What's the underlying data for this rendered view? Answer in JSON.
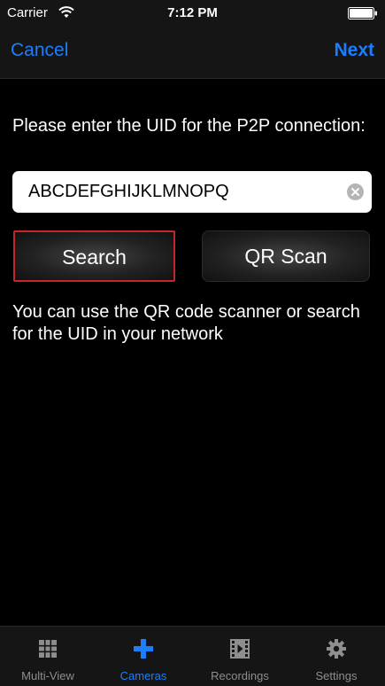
{
  "status_bar": {
    "carrier": "Carrier",
    "time": "7:12 PM"
  },
  "nav": {
    "cancel_label": "Cancel",
    "next_label": "Next"
  },
  "prompt": "Please enter the UID for the P2P connection:",
  "uid_input": {
    "value": "ABCDEFGHIJKLMNOPQ"
  },
  "buttons": {
    "search_label": "Search",
    "qr_scan_label": "QR Scan"
  },
  "hint": "You can use the QR code scanner or search for the UID in your network",
  "tabs": [
    {
      "label": "Multi-View",
      "icon": "grid-icon",
      "active": false
    },
    {
      "label": "Cameras",
      "icon": "plus-icon",
      "active": true
    },
    {
      "label": "Recordings",
      "icon": "film-icon",
      "active": false
    },
    {
      "label": "Settings",
      "icon": "gear-icon",
      "active": false
    }
  ],
  "colors": {
    "accent": "#1a7eff",
    "search_border": "#c4262a",
    "tab_inactive": "#8e8e8e"
  }
}
